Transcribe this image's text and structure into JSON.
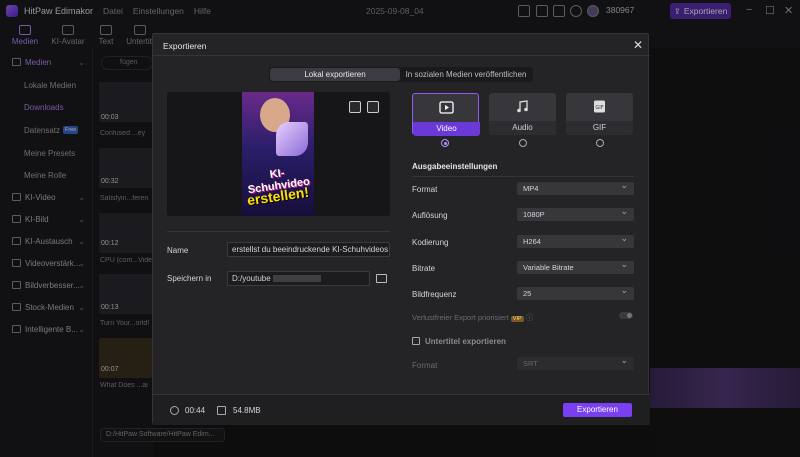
{
  "app": {
    "name": "HitPaw Edimakor",
    "menus": [
      "Datei",
      "Einstellungen",
      "Hilfe"
    ],
    "document_title": "2025-09-08_04",
    "credits": "380967",
    "export_label": "Exportieren",
    "accent_color": "#7b3ff2"
  },
  "nav": {
    "tabs": [
      {
        "label": "Medien",
        "icon": "media-icon"
      },
      {
        "label": "KI-Avatar",
        "icon": "avatar-icon"
      },
      {
        "label": "Text",
        "icon": "text-icon"
      },
      {
        "label": "Untertitl",
        "icon": "subtitle-icon"
      }
    ]
  },
  "sidebar": {
    "items": [
      {
        "label": "Medien"
      },
      {
        "label": "Lokale Medien"
      },
      {
        "label": "Downloads"
      },
      {
        "label": "Datensatz",
        "badge": "Free"
      },
      {
        "label": "Meine Presets"
      },
      {
        "label": "Meine Rolle"
      },
      {
        "label": "KI-Video"
      },
      {
        "label": "KI-Bild"
      },
      {
        "label": "KI-Austausch"
      },
      {
        "label": "Videoverstärk..."
      },
      {
        "label": "Bildverbesser..."
      },
      {
        "label": "Stock-Medien"
      },
      {
        "label": "Intelligente B..."
      }
    ]
  },
  "media": {
    "search_placeholder": "fügen",
    "clips": [
      {
        "duration": "00:03",
        "name": "Confused ...ey"
      },
      {
        "duration": "00:32",
        "name": "Satisfyin...feren"
      },
      {
        "duration": "00:12",
        "name": "CPU (com...Vide"
      },
      {
        "duration": "00:13",
        "name": "Turn Your...orld!"
      },
      {
        "duration": "00:07",
        "name": "What Does ...ai"
      }
    ],
    "bottom_path": "D:/HitPaw Software/HitPaw Edim..."
  },
  "dialog": {
    "title": "Exportieren",
    "close_glyph": "✕",
    "tabs": [
      "Lokal exportieren",
      "In sozialen Medien veröffentlichen"
    ],
    "poster_title_line1": "KI-Schuhvideo",
    "poster_title_line2": "erstellen!",
    "name_label": "Name",
    "name_value": "erstellst du beeindruckende KI-Schuhvideos",
    "save_label": "Speichern in",
    "save_value": "D:/youtube",
    "duration": "00:44",
    "filesize": "54.8MB",
    "export_button": "Exportieren",
    "formats": [
      {
        "label": "Video",
        "icon": "video-file-icon",
        "selected": true
      },
      {
        "label": "Audio",
        "icon": "music-note-icon",
        "selected": false
      },
      {
        "label": "GIF",
        "icon": "gif-file-icon",
        "selected": false
      }
    ],
    "settings_title": "Ausgabeeinstellungen",
    "settings": [
      {
        "label": "Format",
        "value": "MP4"
      },
      {
        "label": "Auflösung",
        "value": "1080P"
      },
      {
        "label": "Kodierung",
        "value": "H264"
      },
      {
        "label": "Bitrate",
        "value": "Variable Bitrate"
      },
      {
        "label": "Bildfrequenz",
        "value": "25"
      }
    ],
    "lossless_label": "Verlustfreier Export priorisiert",
    "vip_badge": "VIP",
    "subtitle_export_label": "Untertitel exportieren",
    "subtitle_format_label": "Format",
    "subtitle_format_value": "SRT"
  }
}
